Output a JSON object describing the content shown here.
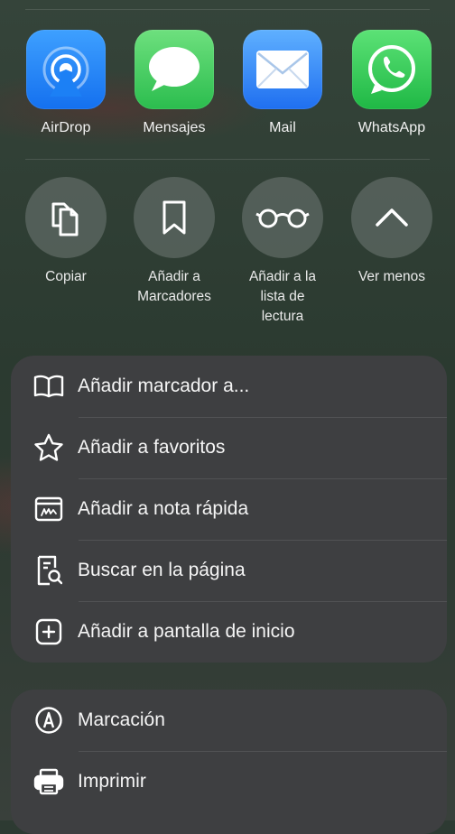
{
  "apps": [
    {
      "label": "AirDrop",
      "icon": "airdrop-icon",
      "color": "#1a8cff"
    },
    {
      "label": "Mensajes",
      "icon": "messages-icon",
      "color": "#33c85a"
    },
    {
      "label": "Mail",
      "icon": "mail-icon",
      "color": "#2f86f6"
    },
    {
      "label": "WhatsApp",
      "icon": "whatsapp-icon",
      "color": "#28c84e"
    }
  ],
  "actions": [
    {
      "label": "Copiar",
      "icon": "copy-icon"
    },
    {
      "label": "Añadir a\nMarcadores",
      "icon": "bookmark-icon"
    },
    {
      "label": "Añadir a la\nlista de\nlectura",
      "icon": "reading-glasses-icon"
    },
    {
      "label": "Ver menos",
      "icon": "chevron-up-icon"
    }
  ],
  "menu": [
    {
      "label": "Añadir marcador a...",
      "icon": "book-icon"
    },
    {
      "label": "Añadir a favoritos",
      "icon": "star-icon"
    },
    {
      "label": "Añadir a nota rápida",
      "icon": "quick-note-icon"
    },
    {
      "label": "Buscar en la página",
      "icon": "find-in-page-icon"
    },
    {
      "label": "Añadir a pantalla de inicio",
      "icon": "add-square-icon"
    }
  ],
  "menu2": [
    {
      "label": "Marcación",
      "icon": "markup-icon"
    },
    {
      "label": "Imprimir",
      "icon": "printer-icon"
    }
  ]
}
